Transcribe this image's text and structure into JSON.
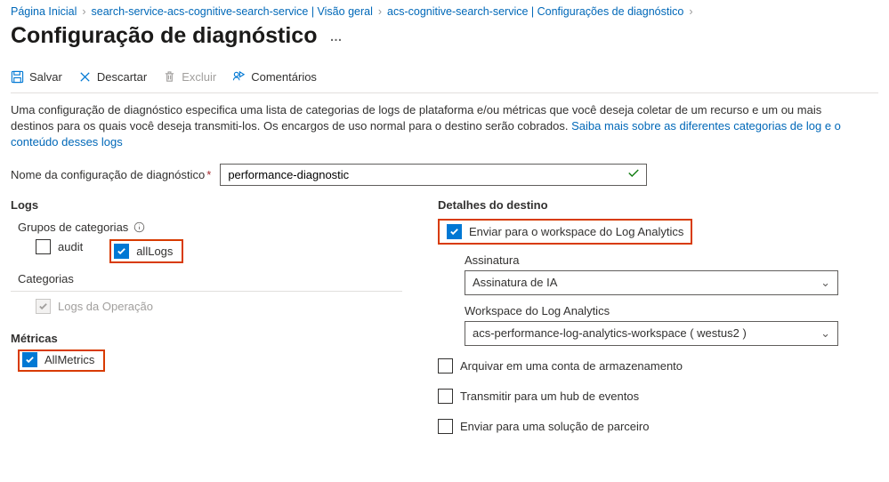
{
  "breadcrumb": {
    "home": "Página Inicial",
    "item1": "search-service-acs-cognitive-search-service | Visão geral",
    "item2": "acs-cognitive-search-service | Configurações de diagnóstico"
  },
  "page_title": "Configuração de diagnóstico",
  "more_ellipsis": "…",
  "toolbar": {
    "save": "Salvar",
    "discard": "Descartar",
    "delete": "Excluir",
    "feedback": "Comentários"
  },
  "desc": {
    "text1": "Uma configuração de diagnóstico especifica uma lista de categorias de logs de plataforma e/ou métricas que você deseja coletar de um recurso e um ou mais destinos para os quais você deseja transmiti-los. Os encargos de uso normal para o destino serão cobrados. ",
    "link": "Saiba mais sobre as diferentes categorias de log e o conteúdo desses logs"
  },
  "name": {
    "label": "Nome da configuração de diagnóstico",
    "value": "performance-diagnostic"
  },
  "left": {
    "logs": "Logs",
    "groups": "Grupos de categorias",
    "audit": "audit",
    "allLogs": "allLogs",
    "categories": "Categorias",
    "opLogs": "Logs da Operação",
    "metrics": "Métricas",
    "allMetrics": "AllMetrics"
  },
  "right": {
    "destination": "Detalhes do destino",
    "sendLA": "Enviar para o workspace do Log Analytics",
    "subscription": "Assinatura",
    "subValue": "Assinatura de IA",
    "workspace": "Workspace do Log Analytics",
    "wsValue": "acs-performance-log-analytics-workspace ( westus2 )",
    "archive": "Arquivar em uma conta de armazenamento",
    "eventhub": "Transmitir para um hub de eventos",
    "partner": "Enviar para uma solução de parceiro"
  }
}
